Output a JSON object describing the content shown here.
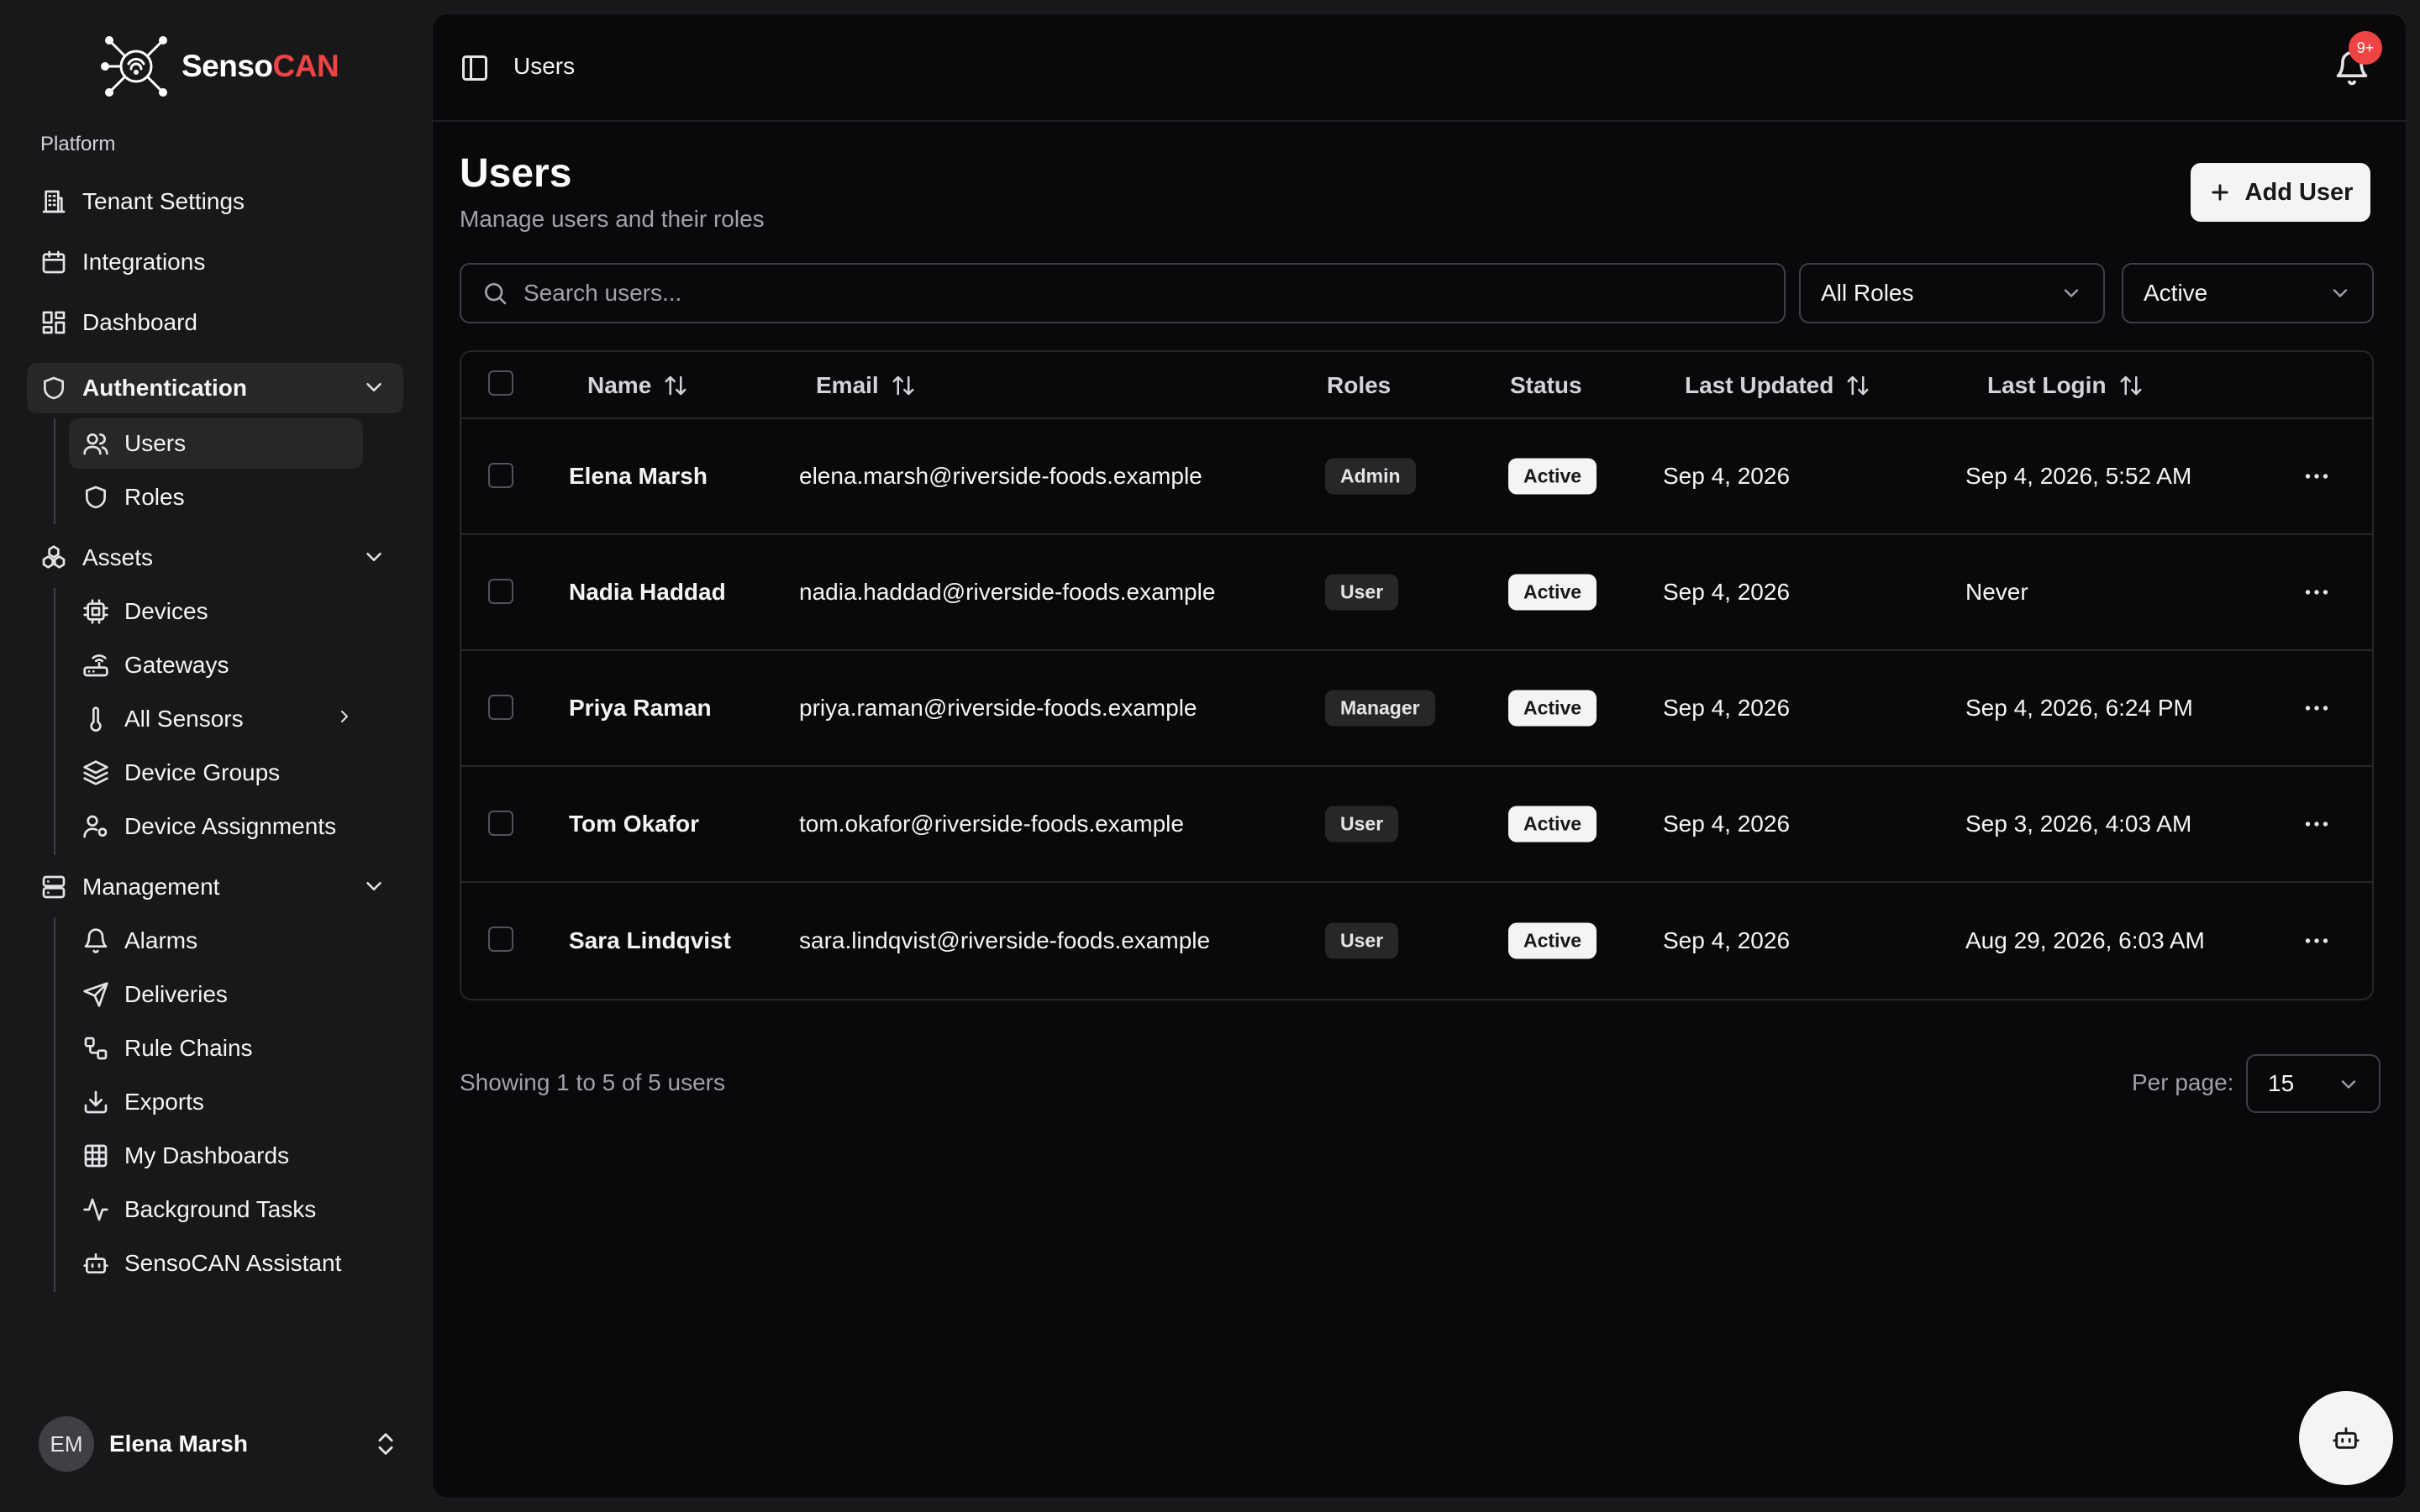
{
  "brand": {
    "name_part1": "Senso",
    "name_part2": "CAN",
    "accent": "#ef4444"
  },
  "sidebar": {
    "group_label": "Platform",
    "items": [
      {
        "label": "Tenant Settings",
        "icon": "building-icon"
      },
      {
        "label": "Integrations",
        "icon": "calendar-icon"
      },
      {
        "label": "Dashboard",
        "icon": "layout-grid-icon"
      }
    ],
    "authentication": {
      "label": "Authentication",
      "children": [
        {
          "label": "Users",
          "icon": "users-icon",
          "selected": true
        },
        {
          "label": "Roles",
          "icon": "shield-icon"
        }
      ]
    },
    "assets": {
      "label": "Assets",
      "children": [
        {
          "label": "Devices",
          "icon": "cpu-icon"
        },
        {
          "label": "Gateways",
          "icon": "router-icon"
        },
        {
          "label": "All Sensors",
          "icon": "thermometer-icon"
        },
        {
          "label": "Device Groups",
          "icon": "layers-icon"
        },
        {
          "label": "Device Assignments",
          "icon": "user-cog-icon"
        }
      ]
    },
    "management": {
      "label": "Management",
      "children": [
        {
          "label": "Alarms",
          "icon": "bell-icon"
        },
        {
          "label": "Deliveries",
          "icon": "send-icon"
        },
        {
          "label": "Rule Chains",
          "icon": "workflow-icon"
        },
        {
          "label": "Exports",
          "icon": "download-icon"
        },
        {
          "label": "My Dashboards",
          "icon": "grid-icon"
        },
        {
          "label": "Background Tasks",
          "icon": "activity-icon"
        },
        {
          "label": "SensoCAN Assistant",
          "icon": "bot-icon"
        }
      ]
    },
    "user": {
      "initials": "EM",
      "name": "Elena Marsh"
    }
  },
  "topbar": {
    "breadcrumb": "Users",
    "notifications_badge": "9+"
  },
  "page": {
    "title": "Users",
    "subtitle": "Manage users and their roles",
    "add_button": "Add User"
  },
  "filters": {
    "search_placeholder": "Search users...",
    "role_filter": "All Roles",
    "status_filter": "Active"
  },
  "table": {
    "columns": {
      "name": "Name",
      "email": "Email",
      "roles": "Roles",
      "status": "Status",
      "last_updated": "Last Updated",
      "last_login": "Last Login"
    },
    "rows": [
      {
        "name": "Elena Marsh",
        "email": "elena.marsh@riverside-foods.example",
        "role": "Admin",
        "status": "Active",
        "last_updated": "Sep 4, 2026",
        "last_login": "Sep 4, 2026, 5:52 AM"
      },
      {
        "name": "Nadia Haddad",
        "email": "nadia.haddad@riverside-foods.example",
        "role": "User",
        "status": "Active",
        "last_updated": "Sep 4, 2026",
        "last_login": "Never"
      },
      {
        "name": "Priya Raman",
        "email": "priya.raman@riverside-foods.example",
        "role": "Manager",
        "status": "Active",
        "last_updated": "Sep 4, 2026",
        "last_login": "Sep 4, 2026, 6:24 PM"
      },
      {
        "name": "Tom Okafor",
        "email": "tom.okafor@riverside-foods.example",
        "role": "User",
        "status": "Active",
        "last_updated": "Sep 4, 2026",
        "last_login": "Sep 3, 2026, 4:03 AM"
      },
      {
        "name": "Sara Lindqvist",
        "email": "sara.lindqvist@riverside-foods.example",
        "role": "User",
        "status": "Active",
        "last_updated": "Sep 4, 2026",
        "last_login": "Aug 29, 2026, 6:03 AM"
      }
    ]
  },
  "pagination": {
    "summary": "Showing 1 to 5 of 5 users",
    "per_page_label": "Per page:",
    "per_page": "15"
  }
}
